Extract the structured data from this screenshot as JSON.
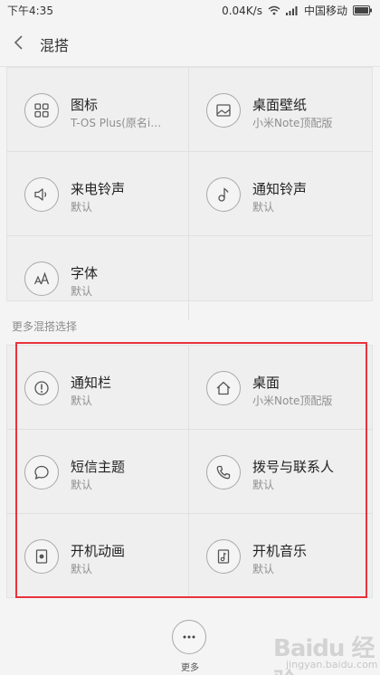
{
  "status_bar": {
    "time": "下午4:35",
    "speed": "0.04K/s",
    "carrier": "中国移动"
  },
  "header": {
    "title": "混搭"
  },
  "top_grid": {
    "items": [
      {
        "title": "图标",
        "subtitle": "T-OS Plus(原名i…",
        "icon": "grid-icon"
      },
      {
        "title": "桌面壁纸",
        "subtitle": "小米Note顶配版",
        "icon": "wallpaper-icon"
      },
      {
        "title": "来电铃声",
        "subtitle": "默认",
        "icon": "speaker-icon"
      },
      {
        "title": "通知铃声",
        "subtitle": "默认",
        "icon": "music-note-icon"
      },
      {
        "title": "字体",
        "subtitle": "默认",
        "icon": "font-icon"
      }
    ]
  },
  "section_label": "更多混搭选择",
  "more_grid": {
    "items": [
      {
        "title": "通知栏",
        "subtitle": "默认",
        "icon": "alert-icon"
      },
      {
        "title": "桌面",
        "subtitle": "小米Note顶配版",
        "icon": "home-icon"
      },
      {
        "title": "短信主题",
        "subtitle": "默认",
        "icon": "message-bubble-icon"
      },
      {
        "title": "拨号与联系人",
        "subtitle": "默认",
        "icon": "phone-icon"
      },
      {
        "title": "开机动画",
        "subtitle": "默认",
        "icon": "boot-animation-icon"
      },
      {
        "title": "开机音乐",
        "subtitle": "默认",
        "icon": "music-file-icon"
      }
    ]
  },
  "more_button": {
    "label": "更多"
  },
  "watermark": {
    "text": "Baidu 经验",
    "sub": "jingyan.baidu.com"
  },
  "colors": {
    "highlight": "#e8333c",
    "background": "#f4f4f4",
    "icon_stroke": "#555555"
  }
}
